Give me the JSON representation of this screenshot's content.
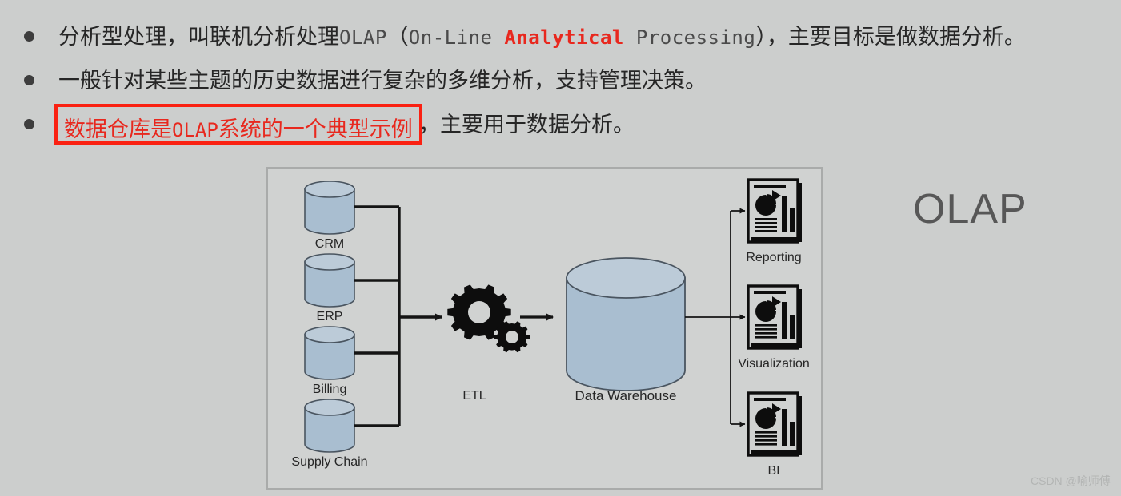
{
  "slide": {
    "background_color": "#cccecd",
    "title_right": "OLAP",
    "watermark": "CSDN @喻师傅"
  },
  "bullets": [
    {
      "marker": "bullet-dot",
      "seg_cn_1": "分析型处理，叫联机分析处理",
      "seg_mono_olap": "OLAP",
      "seg_paren_open": "（",
      "seg_mono_onLine": "On-Line ",
      "seg_mono_red": "Analytical",
      "seg_mono_processing": " Processing",
      "seg_paren_close": "）",
      "seg_cn_2": "，主要目标是做数据分析。"
    },
    {
      "marker": "bullet-dot",
      "text": "一般针对某些主题的历史数据进行复杂的多维分析，支持管理决策。"
    },
    {
      "marker": "bullet-dot",
      "highlight_cn_1": "数据仓库是",
      "highlight_mono": "OLAP",
      "highlight_cn_2": "系统的一个典型示例",
      "tail_text": "，主要用于数据分析。"
    }
  ],
  "diagram": {
    "panel_bg": "#d0d2d1",
    "panel_border": "#a9abaa",
    "cylinder_fill": "#a9bed0",
    "cylinder_stroke": "#4a5560",
    "line_color": "#141414",
    "sources": [
      {
        "label": "CRM"
      },
      {
        "label": "ERP"
      },
      {
        "label": "Billing"
      },
      {
        "label": "Supply Chain"
      }
    ],
    "process": {
      "label": "ETL",
      "icon": "gears-icon"
    },
    "store": {
      "label": "Data Warehouse",
      "icon": "database-cylinder-icon"
    },
    "outputs": [
      {
        "label": "Reporting",
        "icon": "report-document-icon"
      },
      {
        "label": "Visualization",
        "icon": "report-document-icon"
      },
      {
        "label": "BI",
        "icon": "report-document-icon"
      }
    ]
  },
  "colors": {
    "accent_red": "#e8281e",
    "box_red": "#fa2112",
    "text_dark": "#262626",
    "mono_gray": "#4a4a4a",
    "title_gray": "#575757",
    "watermark_gray": "#b3b5b4"
  }
}
